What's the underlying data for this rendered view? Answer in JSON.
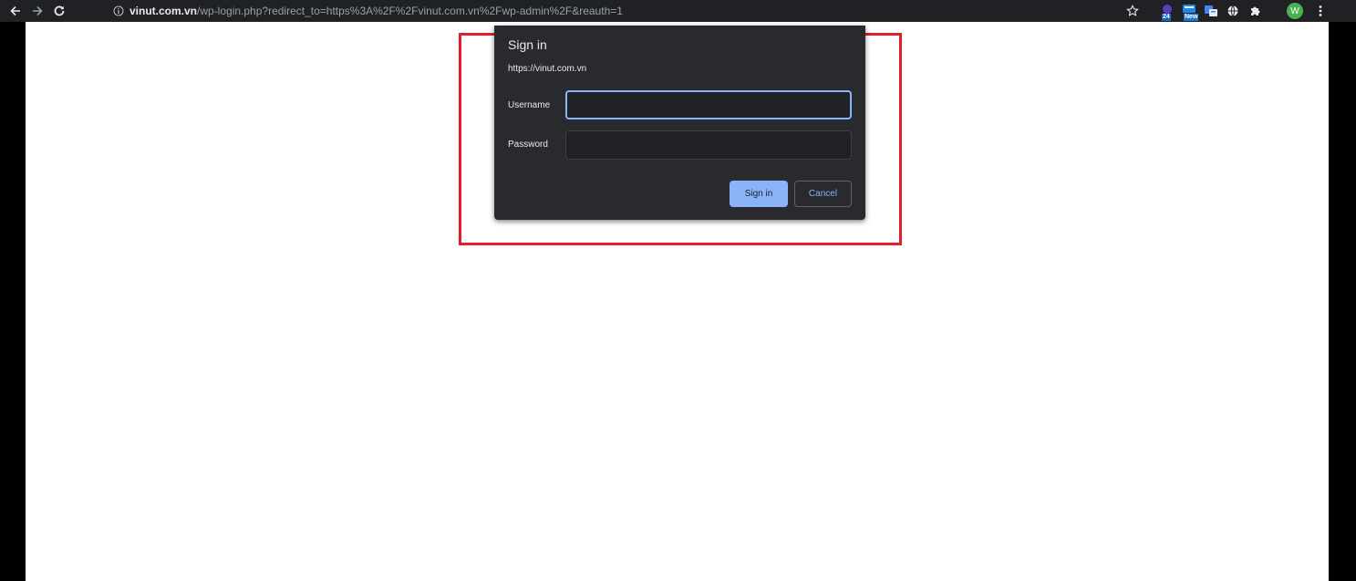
{
  "browser": {
    "url_host": "vinut.com.vn",
    "url_path": "/wp-login.php?redirect_to=https%3A%2F%2Fvinut.com.vn%2Fwp-admin%2F&reauth=1",
    "icons": {
      "back": "back-arrow-icon",
      "forward": "forward-arrow-icon",
      "reload": "reload-icon",
      "info": "info-icon",
      "bookmark": "star-icon",
      "menu": "vertical-dots-icon"
    },
    "extensions": [
      {
        "icon": "extension-24h-icon",
        "badge": "24",
        "color": "#5c3bbf",
        "badge_color": "#1565c0"
      },
      {
        "icon": "extension-new-icon",
        "badge": "New",
        "color": "#1e88e5",
        "badge_color": "#1976d2"
      },
      {
        "icon": "extension-translate-icon",
        "color": "#4285f4"
      },
      {
        "icon": "globe-icon",
        "color": "#e8eaed"
      },
      {
        "icon": "puzzle-icon",
        "color": "#e8eaed"
      }
    ],
    "avatar_initial": "W",
    "avatar_color": "#4caf50"
  },
  "dialog": {
    "title": "Sign in",
    "origin": "https://vinut.com.vn",
    "username_label": "Username",
    "username_value": "",
    "password_label": "Password",
    "password_value": "",
    "sign_in_button": "Sign in",
    "cancel_button": "Cancel"
  },
  "colors": {
    "highlight_border": "#e0202a",
    "dialog_bg": "#292a2d",
    "accent": "#8ab4f8"
  }
}
